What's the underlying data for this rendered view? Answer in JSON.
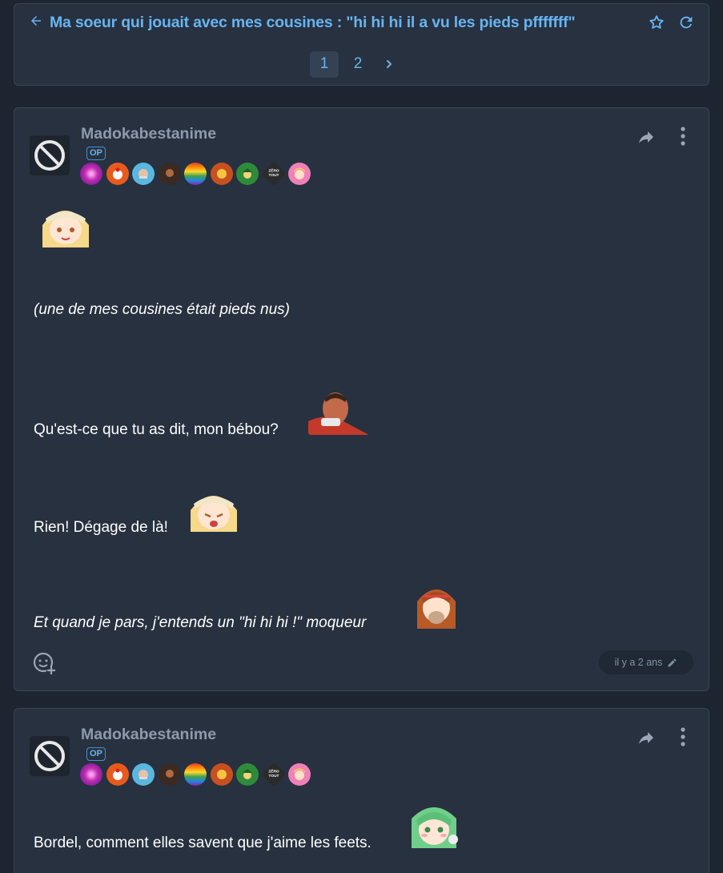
{
  "topic": {
    "title": "Ma soeur qui jouait avec mes cousines : \"hi hi hi il a vu les pieds pfffffff\"",
    "pages": [
      "1",
      "2"
    ],
    "current_page": "1"
  },
  "icons": {
    "back": "arrow-left-icon",
    "favorite": "star-outline-icon",
    "refresh": "refresh-icon",
    "next": "chevron-right-icon",
    "share": "share-arrow-icon",
    "more": "vertical-dots-icon",
    "react": "add-reaction-icon",
    "edit": "pencil-icon",
    "avatar": "banned-circle-icon"
  },
  "colors": {
    "background": "#1c2530",
    "card": "#27313f",
    "accent": "#68b4f0",
    "username": "#8e9aac"
  },
  "posts": [
    {
      "author": "Madokabestanime",
      "op_label": "OP",
      "badge_text": "ZÉRO TOUT",
      "lines": [
        "(une de mes cousines était pieds nus)",
        "Qu'est-ce que tu as dit, mon bébou?",
        "Rien! Dégage de là!",
        "Et quand je pars, j'entends un \"hi hi hi !\" moqueur"
      ],
      "timestamp": "il y a 2 ans"
    },
    {
      "author": "Madokabestanime",
      "op_label": "OP",
      "badge_text": "ZÉRO TOUT",
      "lines": [
        "Bordel, comment elles savent que j'aime les feets."
      ]
    }
  ]
}
